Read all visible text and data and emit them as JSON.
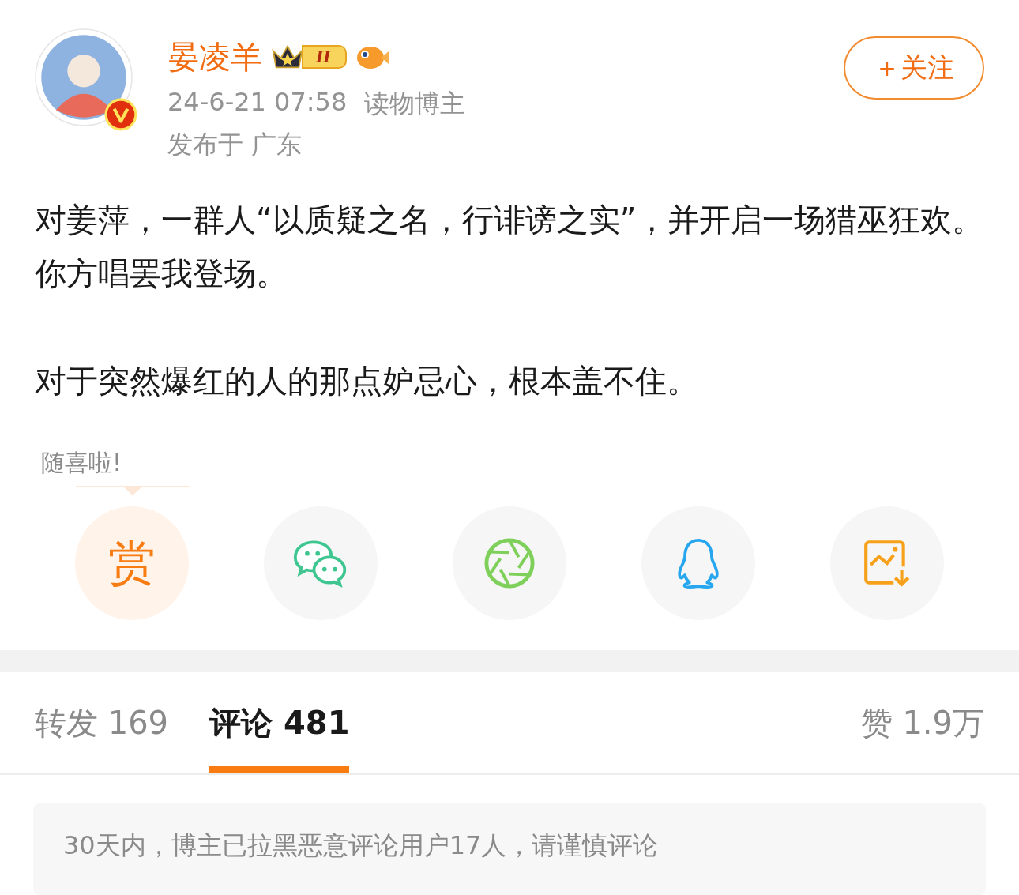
{
  "author": {
    "name": "晏凌羊",
    "level_badge": "II",
    "timestamp": "24-6-21 07:58",
    "role": "读物博主",
    "location": "发布于 广东"
  },
  "follow_button": "＋关注",
  "paragraphs": [
    "对姜萍，一群人“以质疑之名，行诽谤之实”，并开启一场猎巫狂欢。你方唱罢我登场。",
    "对于突然爆红的人的那点妒忌心，根本盖不住。"
  ],
  "reward_tip": "随喜啦!",
  "share_actions": [
    {
      "kind": "reward",
      "label": "赏"
    },
    {
      "kind": "wechat"
    },
    {
      "kind": "moments"
    },
    {
      "kind": "qq"
    },
    {
      "kind": "save-image"
    }
  ],
  "tabs": [
    {
      "label": "转发 169",
      "selected": false
    },
    {
      "label": "评论 481",
      "selected": true
    },
    {
      "label": "赞 1.9万",
      "selected": false
    }
  ],
  "notice": "30天内，博主已拉黑恶意评论用户17人，请谨慎评论"
}
